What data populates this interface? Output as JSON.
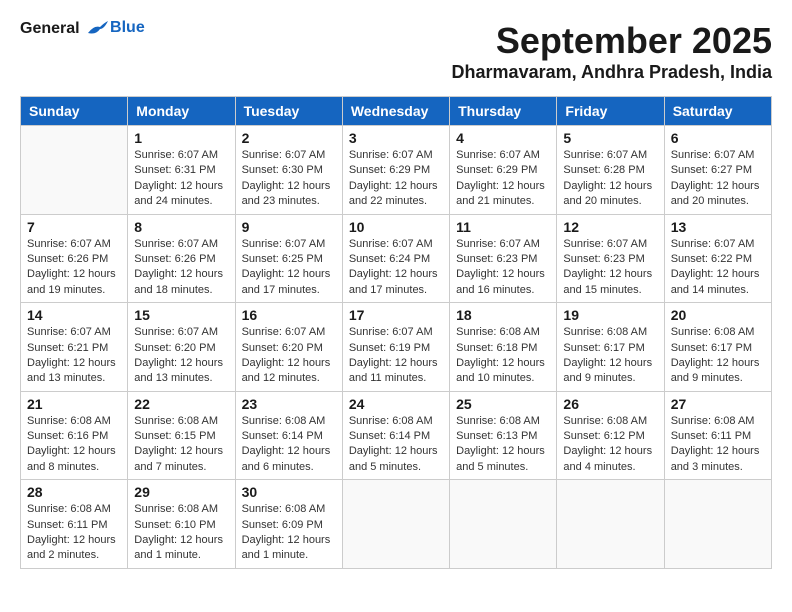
{
  "app": {
    "logo_line1": "General",
    "logo_line2": "Blue"
  },
  "header": {
    "month_year": "September 2025",
    "location": "Dharmavaram, Andhra Pradesh, India"
  },
  "weekdays": [
    "Sunday",
    "Monday",
    "Tuesday",
    "Wednesday",
    "Thursday",
    "Friday",
    "Saturday"
  ],
  "weeks": [
    [
      {
        "day": "",
        "info": ""
      },
      {
        "day": "1",
        "info": "Sunrise: 6:07 AM\nSunset: 6:31 PM\nDaylight: 12 hours\nand 24 minutes."
      },
      {
        "day": "2",
        "info": "Sunrise: 6:07 AM\nSunset: 6:30 PM\nDaylight: 12 hours\nand 23 minutes."
      },
      {
        "day": "3",
        "info": "Sunrise: 6:07 AM\nSunset: 6:29 PM\nDaylight: 12 hours\nand 22 minutes."
      },
      {
        "day": "4",
        "info": "Sunrise: 6:07 AM\nSunset: 6:29 PM\nDaylight: 12 hours\nand 21 minutes."
      },
      {
        "day": "5",
        "info": "Sunrise: 6:07 AM\nSunset: 6:28 PM\nDaylight: 12 hours\nand 20 minutes."
      },
      {
        "day": "6",
        "info": "Sunrise: 6:07 AM\nSunset: 6:27 PM\nDaylight: 12 hours\nand 20 minutes."
      }
    ],
    [
      {
        "day": "7",
        "info": "Sunrise: 6:07 AM\nSunset: 6:26 PM\nDaylight: 12 hours\nand 19 minutes."
      },
      {
        "day": "8",
        "info": "Sunrise: 6:07 AM\nSunset: 6:26 PM\nDaylight: 12 hours\nand 18 minutes."
      },
      {
        "day": "9",
        "info": "Sunrise: 6:07 AM\nSunset: 6:25 PM\nDaylight: 12 hours\nand 17 minutes."
      },
      {
        "day": "10",
        "info": "Sunrise: 6:07 AM\nSunset: 6:24 PM\nDaylight: 12 hours\nand 17 minutes."
      },
      {
        "day": "11",
        "info": "Sunrise: 6:07 AM\nSunset: 6:23 PM\nDaylight: 12 hours\nand 16 minutes."
      },
      {
        "day": "12",
        "info": "Sunrise: 6:07 AM\nSunset: 6:23 PM\nDaylight: 12 hours\nand 15 minutes."
      },
      {
        "day": "13",
        "info": "Sunrise: 6:07 AM\nSunset: 6:22 PM\nDaylight: 12 hours\nand 14 minutes."
      }
    ],
    [
      {
        "day": "14",
        "info": "Sunrise: 6:07 AM\nSunset: 6:21 PM\nDaylight: 12 hours\nand 13 minutes."
      },
      {
        "day": "15",
        "info": "Sunrise: 6:07 AM\nSunset: 6:20 PM\nDaylight: 12 hours\nand 13 minutes."
      },
      {
        "day": "16",
        "info": "Sunrise: 6:07 AM\nSunset: 6:20 PM\nDaylight: 12 hours\nand 12 minutes."
      },
      {
        "day": "17",
        "info": "Sunrise: 6:07 AM\nSunset: 6:19 PM\nDaylight: 12 hours\nand 11 minutes."
      },
      {
        "day": "18",
        "info": "Sunrise: 6:08 AM\nSunset: 6:18 PM\nDaylight: 12 hours\nand 10 minutes."
      },
      {
        "day": "19",
        "info": "Sunrise: 6:08 AM\nSunset: 6:17 PM\nDaylight: 12 hours\nand 9 minutes."
      },
      {
        "day": "20",
        "info": "Sunrise: 6:08 AM\nSunset: 6:17 PM\nDaylight: 12 hours\nand 9 minutes."
      }
    ],
    [
      {
        "day": "21",
        "info": "Sunrise: 6:08 AM\nSunset: 6:16 PM\nDaylight: 12 hours\nand 8 minutes."
      },
      {
        "day": "22",
        "info": "Sunrise: 6:08 AM\nSunset: 6:15 PM\nDaylight: 12 hours\nand 7 minutes."
      },
      {
        "day": "23",
        "info": "Sunrise: 6:08 AM\nSunset: 6:14 PM\nDaylight: 12 hours\nand 6 minutes."
      },
      {
        "day": "24",
        "info": "Sunrise: 6:08 AM\nSunset: 6:14 PM\nDaylight: 12 hours\nand 5 minutes."
      },
      {
        "day": "25",
        "info": "Sunrise: 6:08 AM\nSunset: 6:13 PM\nDaylight: 12 hours\nand 5 minutes."
      },
      {
        "day": "26",
        "info": "Sunrise: 6:08 AM\nSunset: 6:12 PM\nDaylight: 12 hours\nand 4 minutes."
      },
      {
        "day": "27",
        "info": "Sunrise: 6:08 AM\nSunset: 6:11 PM\nDaylight: 12 hours\nand 3 minutes."
      }
    ],
    [
      {
        "day": "28",
        "info": "Sunrise: 6:08 AM\nSunset: 6:11 PM\nDaylight: 12 hours\nand 2 minutes."
      },
      {
        "day": "29",
        "info": "Sunrise: 6:08 AM\nSunset: 6:10 PM\nDaylight: 12 hours\nand 1 minute."
      },
      {
        "day": "30",
        "info": "Sunrise: 6:08 AM\nSunset: 6:09 PM\nDaylight: 12 hours\nand 1 minute."
      },
      {
        "day": "",
        "info": ""
      },
      {
        "day": "",
        "info": ""
      },
      {
        "day": "",
        "info": ""
      },
      {
        "day": "",
        "info": ""
      }
    ]
  ]
}
